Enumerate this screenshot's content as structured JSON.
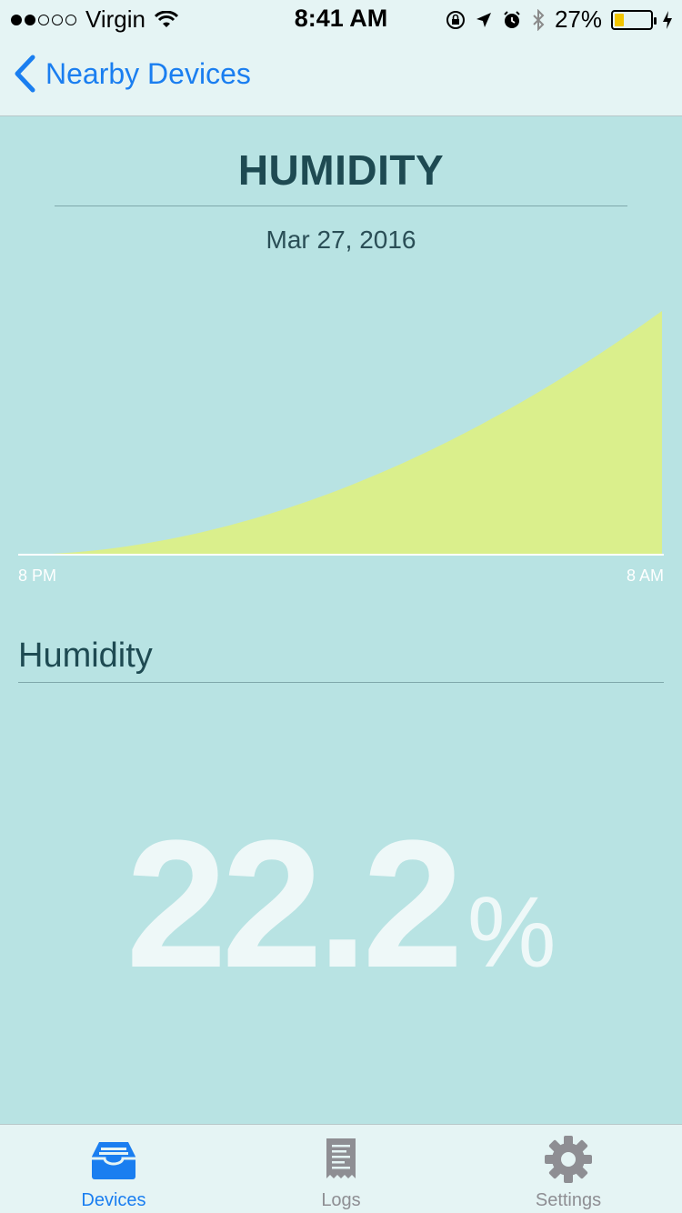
{
  "status_bar": {
    "carrier": "Virgin",
    "time": "8:41 AM",
    "battery_percent": "27%",
    "battery_level": 0.27,
    "signal_bars_filled": 2,
    "signal_bars_total": 5
  },
  "nav": {
    "back_label": "Nearby Devices",
    "back_icon": "chevron-left-icon"
  },
  "chart_header": {
    "title": "HUMIDITY",
    "date": "Mar 27, 2016"
  },
  "chart_data": {
    "type": "area",
    "x": [
      "8 PM",
      "8 AM"
    ],
    "x_tick_labels": [
      "8 PM",
      "8 AM"
    ],
    "shape": "monotonically increasing, convex curve",
    "title": "HUMIDITY",
    "subtitle": "Mar 27, 2016",
    "fill_color": "#daef8c",
    "grid": false
  },
  "reading": {
    "section_title": "Humidity",
    "value": "22.2",
    "unit": "%"
  },
  "tabs": [
    {
      "label": "Devices",
      "icon": "tray-icon",
      "active": true
    },
    {
      "label": "Logs",
      "icon": "receipt-icon",
      "active": false
    },
    {
      "label": "Settings",
      "icon": "gear-icon",
      "active": false
    }
  ],
  "colors": {
    "accent": "#1a7ef0",
    "background": "#b8e3e3",
    "bar_background": "#e5f4f4",
    "title_text": "#1e4a52",
    "battery_fill": "#f2c500"
  }
}
